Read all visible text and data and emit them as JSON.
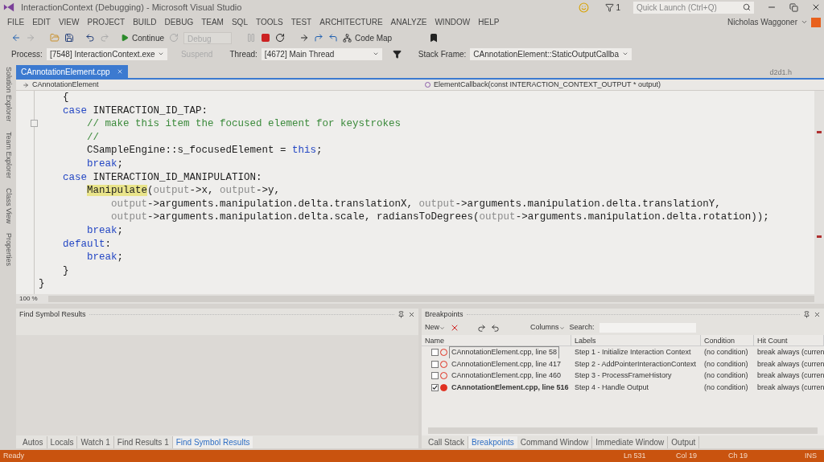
{
  "title_bar": {
    "title": "InteractionContext (Debugging) - Microsoft Visual Studio",
    "notification_count": "1",
    "quick_launch": {
      "placeholder": "Quick Launch (Ctrl+Q)"
    }
  },
  "menu": {
    "items": [
      "FILE",
      "EDIT",
      "VIEW",
      "PROJECT",
      "BUILD",
      "DEBUG",
      "TEAM",
      "SQL",
      "TOOLS",
      "TEST",
      "ARCHITECTURE",
      "ANALYZE",
      "WINDOW",
      "HELP"
    ],
    "user": "Nicholas Waggoner"
  },
  "toolbar": {
    "continue": "Continue",
    "configuration": {
      "value": "Debug",
      "disabled": true
    },
    "code_map": "Code Map"
  },
  "debug_location": {
    "process_label": "Process:",
    "process": "[7548] InteractionContext.exe",
    "suspend": {
      "label": "Suspend",
      "disabled": true
    },
    "thread_label": "Thread:",
    "thread": "[4672] Main Thread",
    "stack_frame_label": "Stack Frame:",
    "stack_frame": "CAnnotationElement::StaticOutputCallba"
  },
  "side_tabs": [
    "Solution Explorer",
    "Team Explorer",
    "Class View",
    "Properties"
  ],
  "editor": {
    "tabs": [
      {
        "label": "CAnnotationElement.cpp",
        "selected": true
      }
    ],
    "preview_tab": "d2d1.h",
    "nav_scope": "CAnnotationElement",
    "nav_member": "ElementCallback(const INTERACTION_CONTEXT_OUTPUT * output)",
    "zoom": "100 %",
    "lines": [
      {
        "tokens": [
          {
            "text": "    {",
            "kind": "plain"
          }
        ]
      },
      {
        "tokens": [
          {
            "text": "    case",
            "kind": "keyword"
          },
          {
            "text": " INTERACTION_ID_TAP:",
            "kind": "plain"
          }
        ]
      },
      {
        "tokens": [
          {
            "text": "        // make this item the focused element for keystrokes",
            "kind": "comment"
          }
        ]
      },
      {
        "tokens": [
          {
            "text": "        //",
            "kind": "comment"
          }
        ]
      },
      {
        "tokens": [
          {
            "text": "        CSampleEngine::s_focusedElement = ",
            "kind": "plain"
          },
          {
            "text": "this",
            "kind": "keyword"
          },
          {
            "text": ";",
            "kind": "plain"
          }
        ]
      },
      {
        "tokens": [
          {
            "text": "        break",
            "kind": "keyword"
          },
          {
            "text": ";",
            "kind": "plain"
          }
        ]
      },
      {
        "tokens": [
          {
            "text": "    case",
            "kind": "keyword"
          },
          {
            "text": " INTERACTION_ID_MANIPULATION:",
            "kind": "plain"
          }
        ]
      },
      {
        "tokens": [
          {
            "text": "        Manipulate",
            "kind": "highlight"
          },
          {
            "text": "(",
            "kind": "plain"
          },
          {
            "text": "output",
            "kind": "param"
          },
          {
            "text": "->x, ",
            "kind": "plain"
          },
          {
            "text": "output",
            "kind": "param"
          },
          {
            "text": "->y,",
            "kind": "plain"
          }
        ]
      },
      {
        "tokens": [
          {
            "text": "            output",
            "kind": "param"
          },
          {
            "text": "->arguments.manipulation.delta.translationX, ",
            "kind": "plain"
          },
          {
            "text": "output",
            "kind": "param"
          },
          {
            "text": "->arguments.manipulation.delta.translationY,",
            "kind": "plain"
          }
        ]
      },
      {
        "tokens": [
          {
            "text": "            output",
            "kind": "param"
          },
          {
            "text": "->arguments.manipulation.delta.scale, radiansToDegrees(",
            "kind": "plain"
          },
          {
            "text": "output",
            "kind": "param"
          },
          {
            "text": "->arguments.manipulation.delta.rotation));",
            "kind": "plain"
          }
        ]
      },
      {
        "tokens": [
          {
            "text": "        break",
            "kind": "keyword"
          },
          {
            "text": ";",
            "kind": "plain"
          }
        ]
      },
      {
        "tokens": [
          {
            "text": "    default",
            "kind": "keyword"
          },
          {
            "text": ":",
            "kind": "plain"
          }
        ]
      },
      {
        "tokens": [
          {
            "text": "        break",
            "kind": "keyword"
          },
          {
            "text": ";",
            "kind": "plain"
          }
        ]
      },
      {
        "tokens": [
          {
            "text": "    }",
            "kind": "plain"
          }
        ]
      },
      {
        "tokens": [
          {
            "text": "}",
            "kind": "plain"
          }
        ]
      }
    ]
  },
  "find_symbol_panel": {
    "title": "Find Symbol Results",
    "tabs": [
      {
        "label": "Autos",
        "selected": false
      },
      {
        "label": "Locals",
        "selected": false
      },
      {
        "label": "Watch 1",
        "selected": false
      },
      {
        "label": "Find Results 1",
        "selected": false
      },
      {
        "label": "Find Symbol Results",
        "selected": true
      }
    ]
  },
  "breakpoints_panel": {
    "title": "Breakpoints",
    "new": "New",
    "columns_button": "Columns",
    "search_label": "Search:",
    "columns": [
      "Name",
      "Labels",
      "Condition",
      "Hit Count"
    ],
    "rows": [
      {
        "name": "CAnnotationElement.cpp, line 58",
        "label": "Step 1 - Initialize Interaction Context",
        "condition": "(no condition)",
        "hit_count": "break always (curren",
        "enabled": false,
        "current": false,
        "selected": true
      },
      {
        "name": "CAnnotationElement.cpp, line 417",
        "label": "Step 2 - AddPointerInteractionContext",
        "condition": "(no condition)",
        "hit_count": "break always (curren",
        "enabled": false,
        "current": false,
        "selected": false
      },
      {
        "name": "CAnnotationElement.cpp, line 460",
        "label": "Step 3 - ProcessFrameHistory",
        "condition": "(no condition)",
        "hit_count": "break always (curren",
        "enabled": false,
        "current": false,
        "selected": false
      },
      {
        "name": "CAnnotationElement.cpp, line 516",
        "label": "Step 4 - Handle Output",
        "condition": "(no condition)",
        "hit_count": "break always (curren",
        "enabled": true,
        "current": true,
        "selected": false
      }
    ],
    "tabs": [
      {
        "label": "Call Stack",
        "selected": false
      },
      {
        "label": "Breakpoints",
        "selected": true
      },
      {
        "label": "Command Window",
        "selected": false
      },
      {
        "label": "Immediate Window",
        "selected": false
      },
      {
        "label": "Output",
        "selected": false
      }
    ]
  },
  "status_bar": {
    "message": "Ready",
    "line": "Ln 531",
    "column": "Col 19",
    "char": "Ch 19",
    "mode": "INS"
  }
}
